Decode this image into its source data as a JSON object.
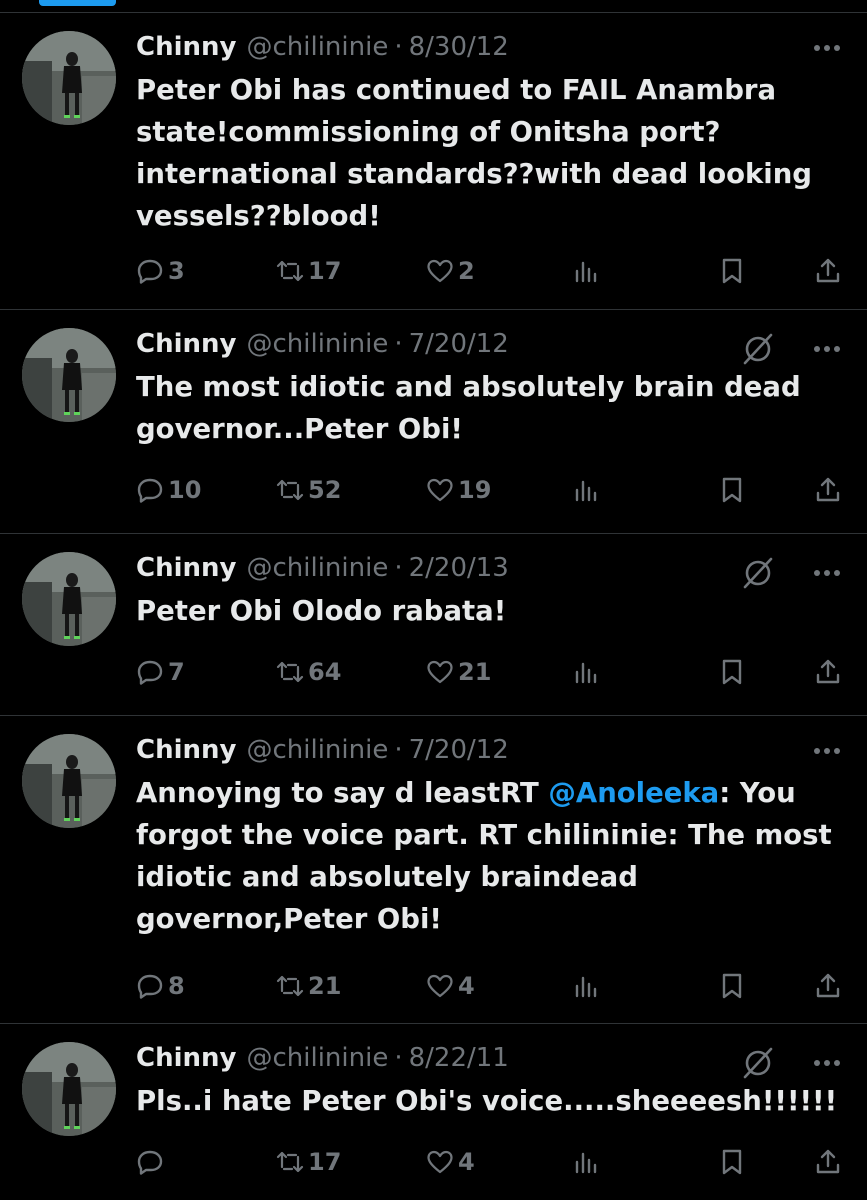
{
  "colors": {
    "background": "#000000",
    "text": "#e7e9ea",
    "secondary": "#71767b",
    "accent": "#1d9bf0",
    "divider": "#2f3336"
  },
  "tweets": [
    {
      "name": "Chinny",
      "handle": "@chilininie",
      "separator": "·",
      "date": "8/30/12",
      "text_parts": [
        "Peter Obi has continued to FAIL Anambra state!commissioning of Onitsha port? international standards??with dead looking vessels??blood!"
      ],
      "replies": "3",
      "retweets": "17",
      "likes": "2",
      "grok": false
    },
    {
      "name": "Chinny",
      "handle": "@chilininie",
      "separator": "·",
      "date": "7/20/12",
      "text_parts": [
        "The most idiotic and absolutely brain dead governor...Peter Obi!"
      ],
      "replies": "10",
      "retweets": "52",
      "likes": "19",
      "grok": true
    },
    {
      "name": "Chinny",
      "handle": "@chilininie",
      "separator": "·",
      "date": "2/20/13",
      "text_parts": [
        "Peter Obi Olodo rabata!"
      ],
      "replies": "7",
      "retweets": "64",
      "likes": "21",
      "grok": true
    },
    {
      "name": "Chinny",
      "handle": "@chilininie",
      "separator": "·",
      "date": "7/20/12",
      "text_parts": [
        "Annoying to say d leastRT ",
        "@Anoleeka",
        ": You forgot the voice part. RT chilininie: The most idiotic and absolutely braindead governor,Peter Obi!"
      ],
      "replies": "8",
      "retweets": "21",
      "likes": "4",
      "grok": false
    },
    {
      "name": "Chinny",
      "handle": "@chilininie",
      "separator": "·",
      "date": "8/22/11",
      "text_parts": [
        "Pls..i hate Peter Obi's voice.....sheeeesh!!!!!!"
      ],
      "replies": "",
      "retweets": "17",
      "likes": "4",
      "grok": true
    }
  ]
}
